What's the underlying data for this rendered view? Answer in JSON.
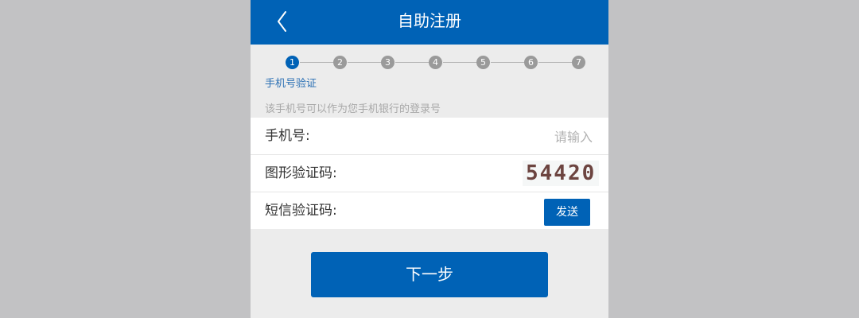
{
  "header": {
    "title": "自助注册",
    "back_icon": "chevron-left-icon"
  },
  "steps": {
    "items": [
      "1",
      "2",
      "3",
      "4",
      "5",
      "6",
      "7"
    ],
    "active_index": 0,
    "current_label": "手机号验证"
  },
  "hint": "该手机号可以作为您手机银行的登录号",
  "form": {
    "phone": {
      "label": "手机号:",
      "placeholder": "请输入",
      "value": ""
    },
    "captcha": {
      "label": "图形验证码:",
      "image_text": "54420"
    },
    "sms": {
      "label": "短信验证码:",
      "send_label": "发送"
    }
  },
  "next_label": "下一步",
  "colors": {
    "primary": "#0062b6",
    "page_bg": "#ececec",
    "outer_bg": "#c2c2c4",
    "step_inactive": "#9a9a9a"
  }
}
